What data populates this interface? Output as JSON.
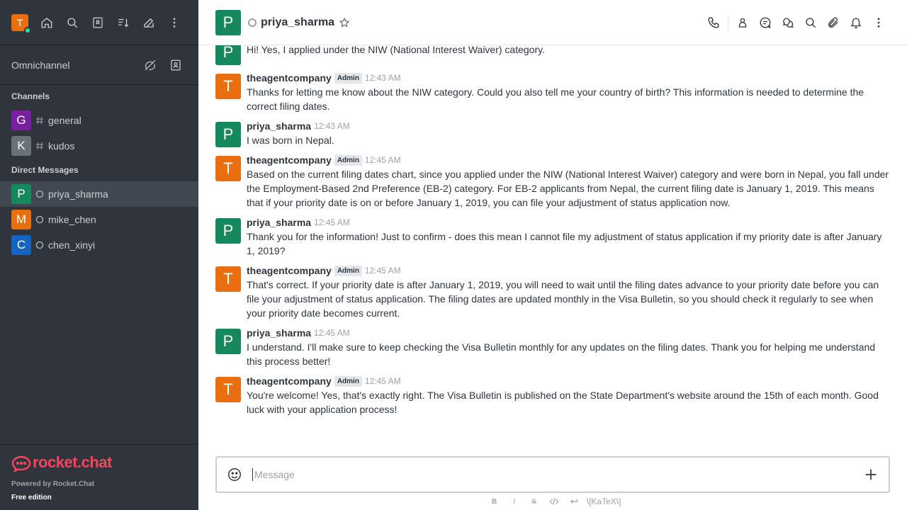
{
  "sidebar": {
    "user_initial": "T",
    "user_avatar_color": "#e96e10",
    "omnichannel_label": "Omnichannel",
    "channels_title": "Channels",
    "channels": [
      {
        "initial": "G",
        "name": "general",
        "color": "#7b1fa2"
      },
      {
        "initial": "K",
        "name": "kudos",
        "color": "#6c727a"
      }
    ],
    "dm_title": "Direct Messages",
    "dms": [
      {
        "initial": "P",
        "name": "priya_sharma",
        "color": "#15895d",
        "active": true
      },
      {
        "initial": "M",
        "name": "mike_chen",
        "color": "#e96e10"
      },
      {
        "initial": "C",
        "name": "chen_xinyi",
        "color": "#1565c0"
      }
    ],
    "footer": {
      "logo_text": "rocket.chat",
      "powered_by": "Powered by Rocket.Chat",
      "edition": "Free edition"
    }
  },
  "header": {
    "room_initial": "P",
    "room_name": "priya_sharma"
  },
  "messages": [
    {
      "initial": "P",
      "color": "#15895d",
      "user": "",
      "badge": "",
      "time": "",
      "text": "Hi! Yes, I applied under the NIW (National Interest Waiver) category."
    },
    {
      "initial": "T",
      "color": "#e96e10",
      "user": "theagentcompany",
      "badge": "Admin",
      "time": "12:43 AM",
      "text": "Thanks for letting me know about the NIW category. Could you also tell me your country of birth? This information is needed to determine the correct filing dates."
    },
    {
      "initial": "P",
      "color": "#15895d",
      "user": "priya_sharma",
      "badge": "",
      "time": "12:43 AM",
      "text": "I was born in Nepal."
    },
    {
      "initial": "T",
      "color": "#e96e10",
      "user": "theagentcompany",
      "badge": "Admin",
      "time": "12:45 AM",
      "text": "Based on the current filing dates chart, since you applied under the NIW (National Interest Waiver) category and were born in Nepal, you fall under the Employment-Based 2nd Preference (EB-2) category. For EB-2 applicants from Nepal, the current filing date is January 1, 2019. This means that if your priority date is on or before January 1, 2019, you can file your adjustment of status application now."
    },
    {
      "initial": "P",
      "color": "#15895d",
      "user": "priya_sharma",
      "badge": "",
      "time": "12:45 AM",
      "text": "Thank you for the information! Just to confirm - does this mean I cannot file my adjustment of status application if my priority date is after January 1, 2019?"
    },
    {
      "initial": "T",
      "color": "#e96e10",
      "user": "theagentcompany",
      "badge": "Admin",
      "time": "12:45 AM",
      "text": "That's correct. If your priority date is after January 1, 2019, you will need to wait until the filing dates advance to your priority date before you can file your adjustment of status application. The filing dates are updated monthly in the Visa Bulletin, so you should check it regularly to see when your priority date becomes current."
    },
    {
      "initial": "P",
      "color": "#15895d",
      "user": "priya_sharma",
      "badge": "",
      "time": "12:45 AM",
      "text": "I understand. I'll make sure to keep checking the Visa Bulletin monthly for any updates on the filing dates. Thank you for helping me understand this process better!"
    },
    {
      "initial": "T",
      "color": "#e96e10",
      "user": "theagentcompany",
      "badge": "Admin",
      "time": "12:45 AM",
      "text": "You're welcome! Yes, that's exactly right. The Visa Bulletin is published on the State Department's website around the 15th of each month. Good luck with your application process!"
    }
  ],
  "composer": {
    "placeholder": "Message",
    "katex_label": "\\[KaTeX\\]",
    "bold": "B",
    "italic": "I",
    "strike": "S"
  }
}
